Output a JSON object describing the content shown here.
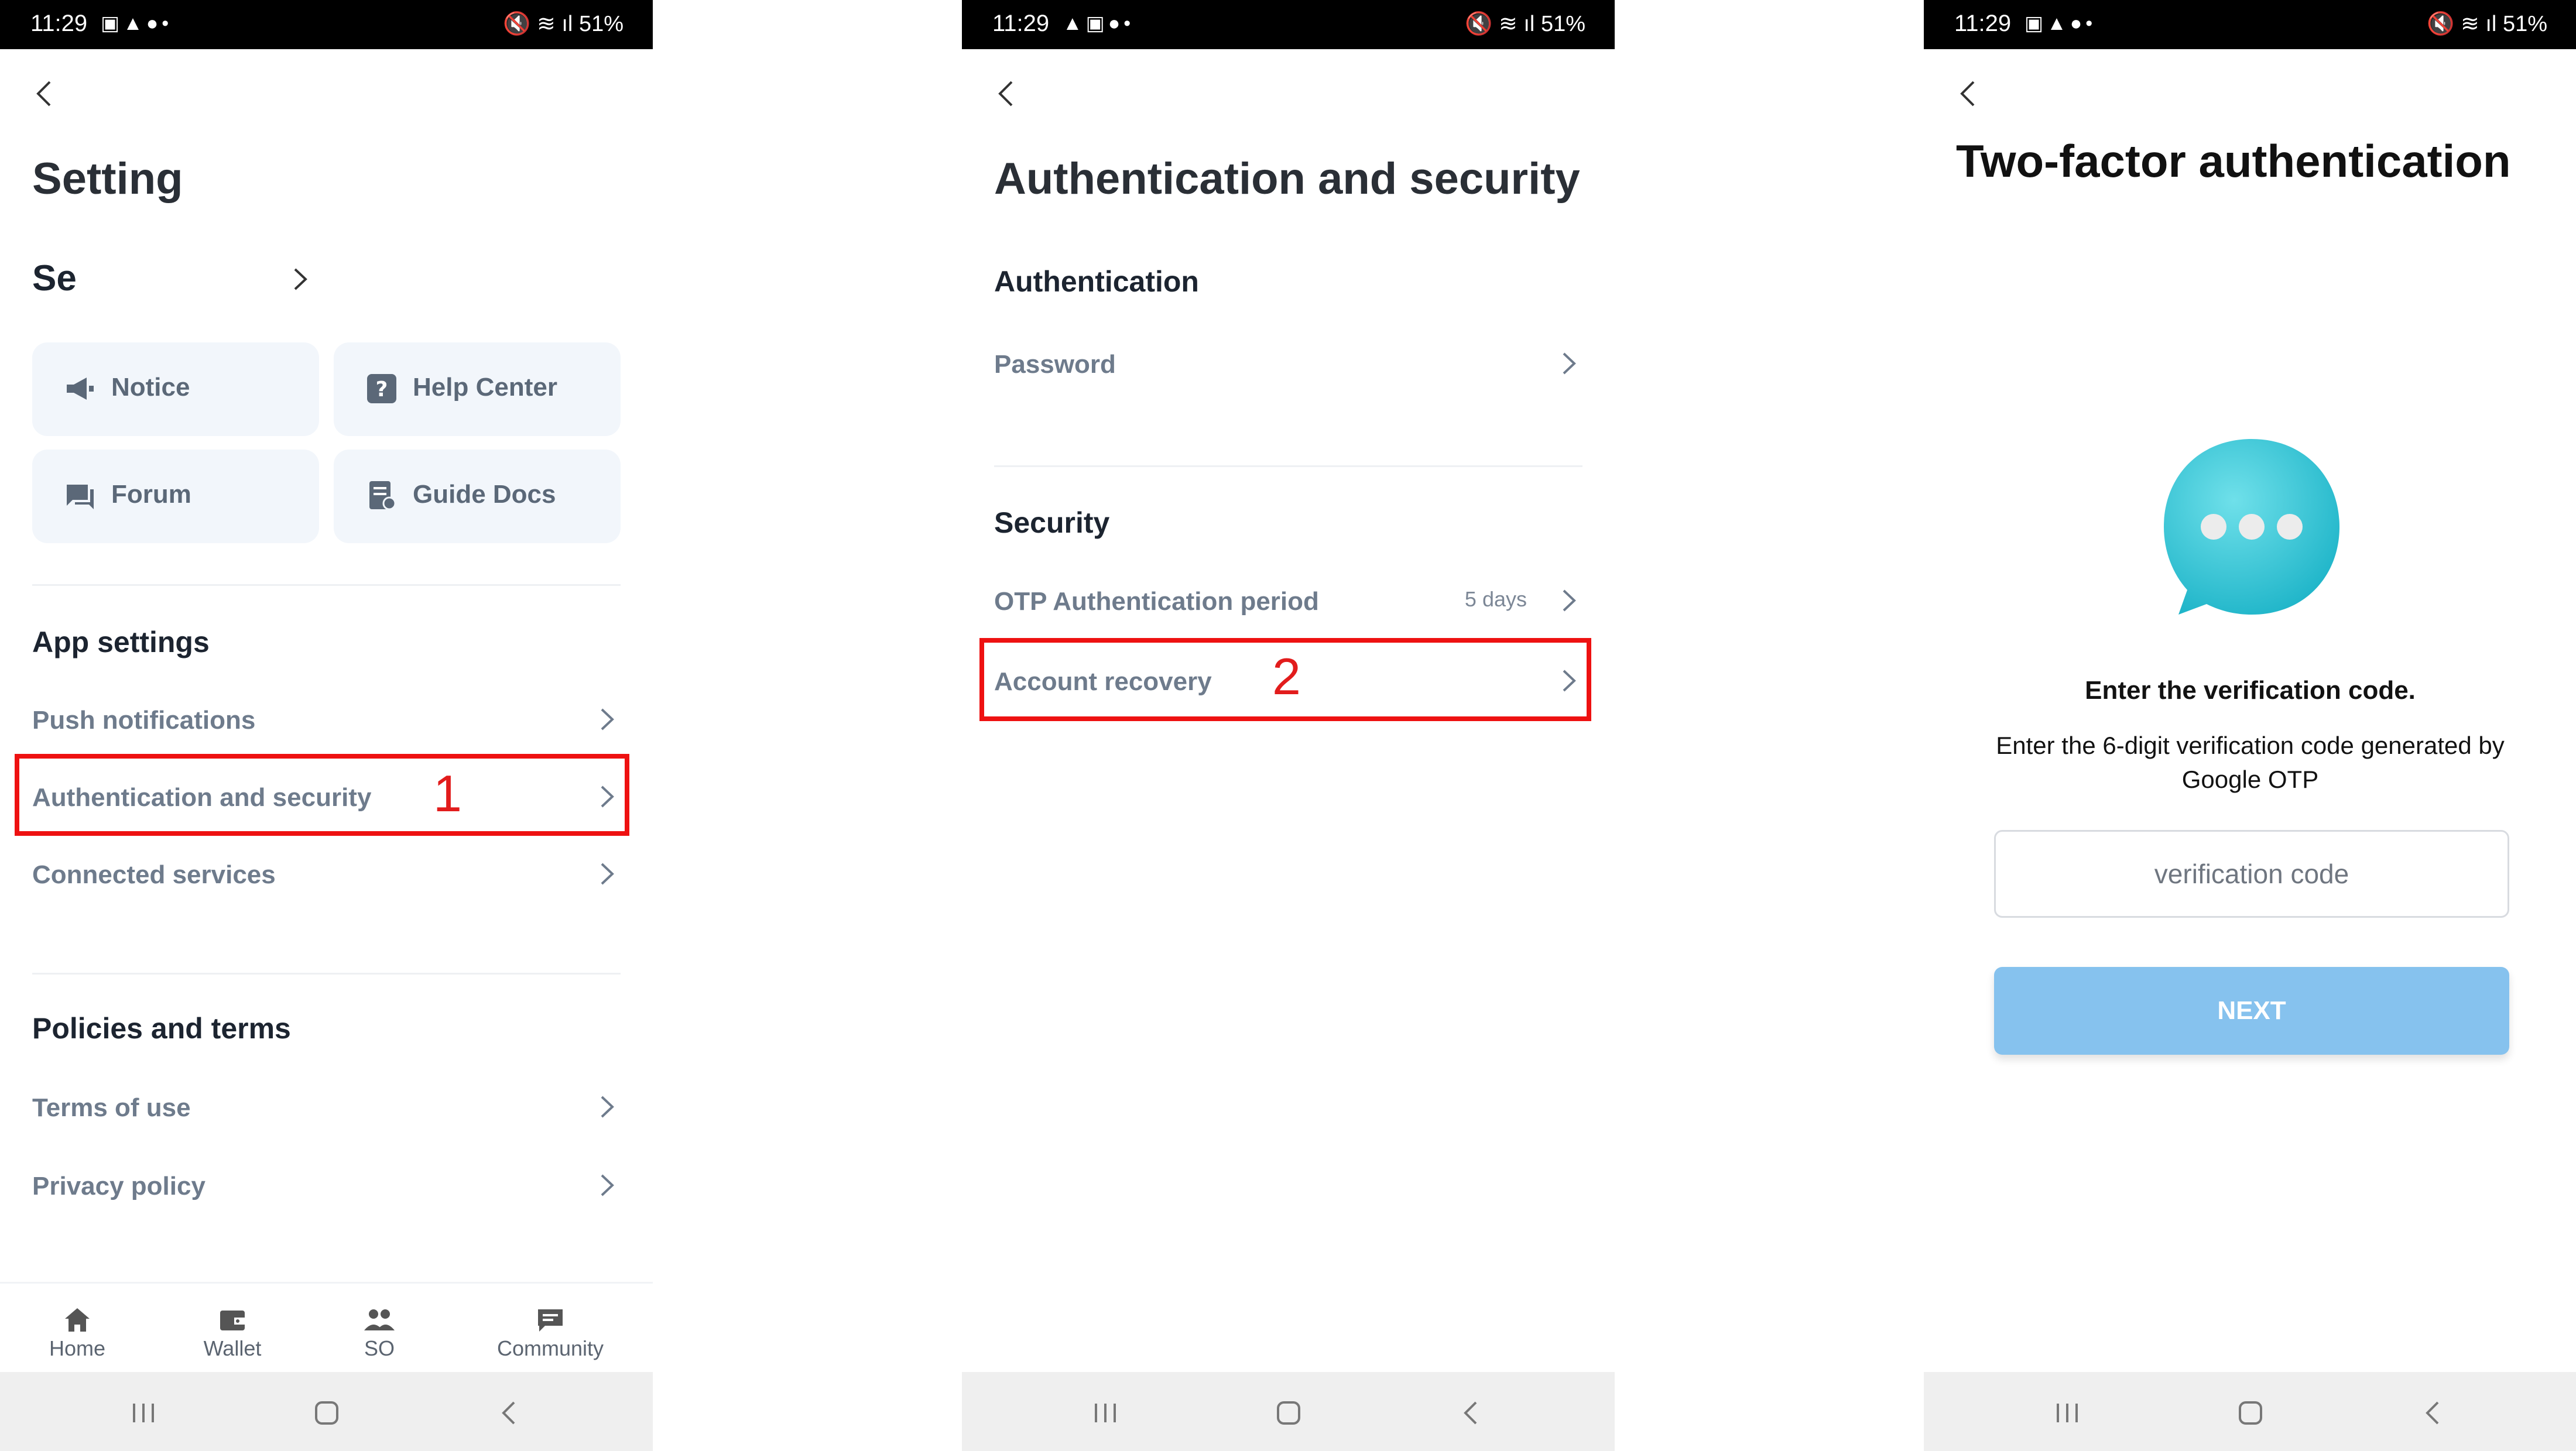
{
  "status_bar": {
    "time": "11:29",
    "battery": "51%"
  },
  "screen1": {
    "title": "Setting",
    "profile_name": "Se",
    "tiles": [
      {
        "label": "Notice",
        "icon": "megaphone-icon"
      },
      {
        "label": "Help Center",
        "icon": "question-icon"
      },
      {
        "label": "Forum",
        "icon": "chat-icon"
      },
      {
        "label": "Guide Docs",
        "icon": "document-icon"
      }
    ],
    "app_settings": {
      "heading": "App settings",
      "items": [
        "Push notifications",
        "Authentication and security",
        "Connected services"
      ]
    },
    "policies": {
      "heading": "Policies and terms",
      "items": [
        "Terms of use",
        "Privacy policy"
      ]
    },
    "step_marker": "1",
    "tabs": [
      {
        "label": "Home",
        "icon": "home-icon"
      },
      {
        "label": "Wallet",
        "icon": "wallet-icon"
      },
      {
        "label": "SO",
        "icon": "people-icon"
      },
      {
        "label": "Community",
        "icon": "community-icon"
      }
    ]
  },
  "screen2": {
    "title": "Authentication and security",
    "authentication": {
      "heading": "Authentication",
      "items": [
        "Password"
      ]
    },
    "security": {
      "heading": "Security",
      "otp_label": "OTP Authentication period",
      "otp_value": "5 days",
      "recovery_label": "Account recovery"
    },
    "step_marker": "2"
  },
  "screen3": {
    "title": "Two-factor authentication",
    "heading": "Enter the verification code.",
    "description": "Enter the 6-digit verification code generated by Google OTP",
    "input_placeholder": "verification code",
    "next_label": "NEXT"
  },
  "colors": {
    "accent": "#86c2ee",
    "highlight": "#ee1111",
    "bubble": "#3cc8d8"
  }
}
